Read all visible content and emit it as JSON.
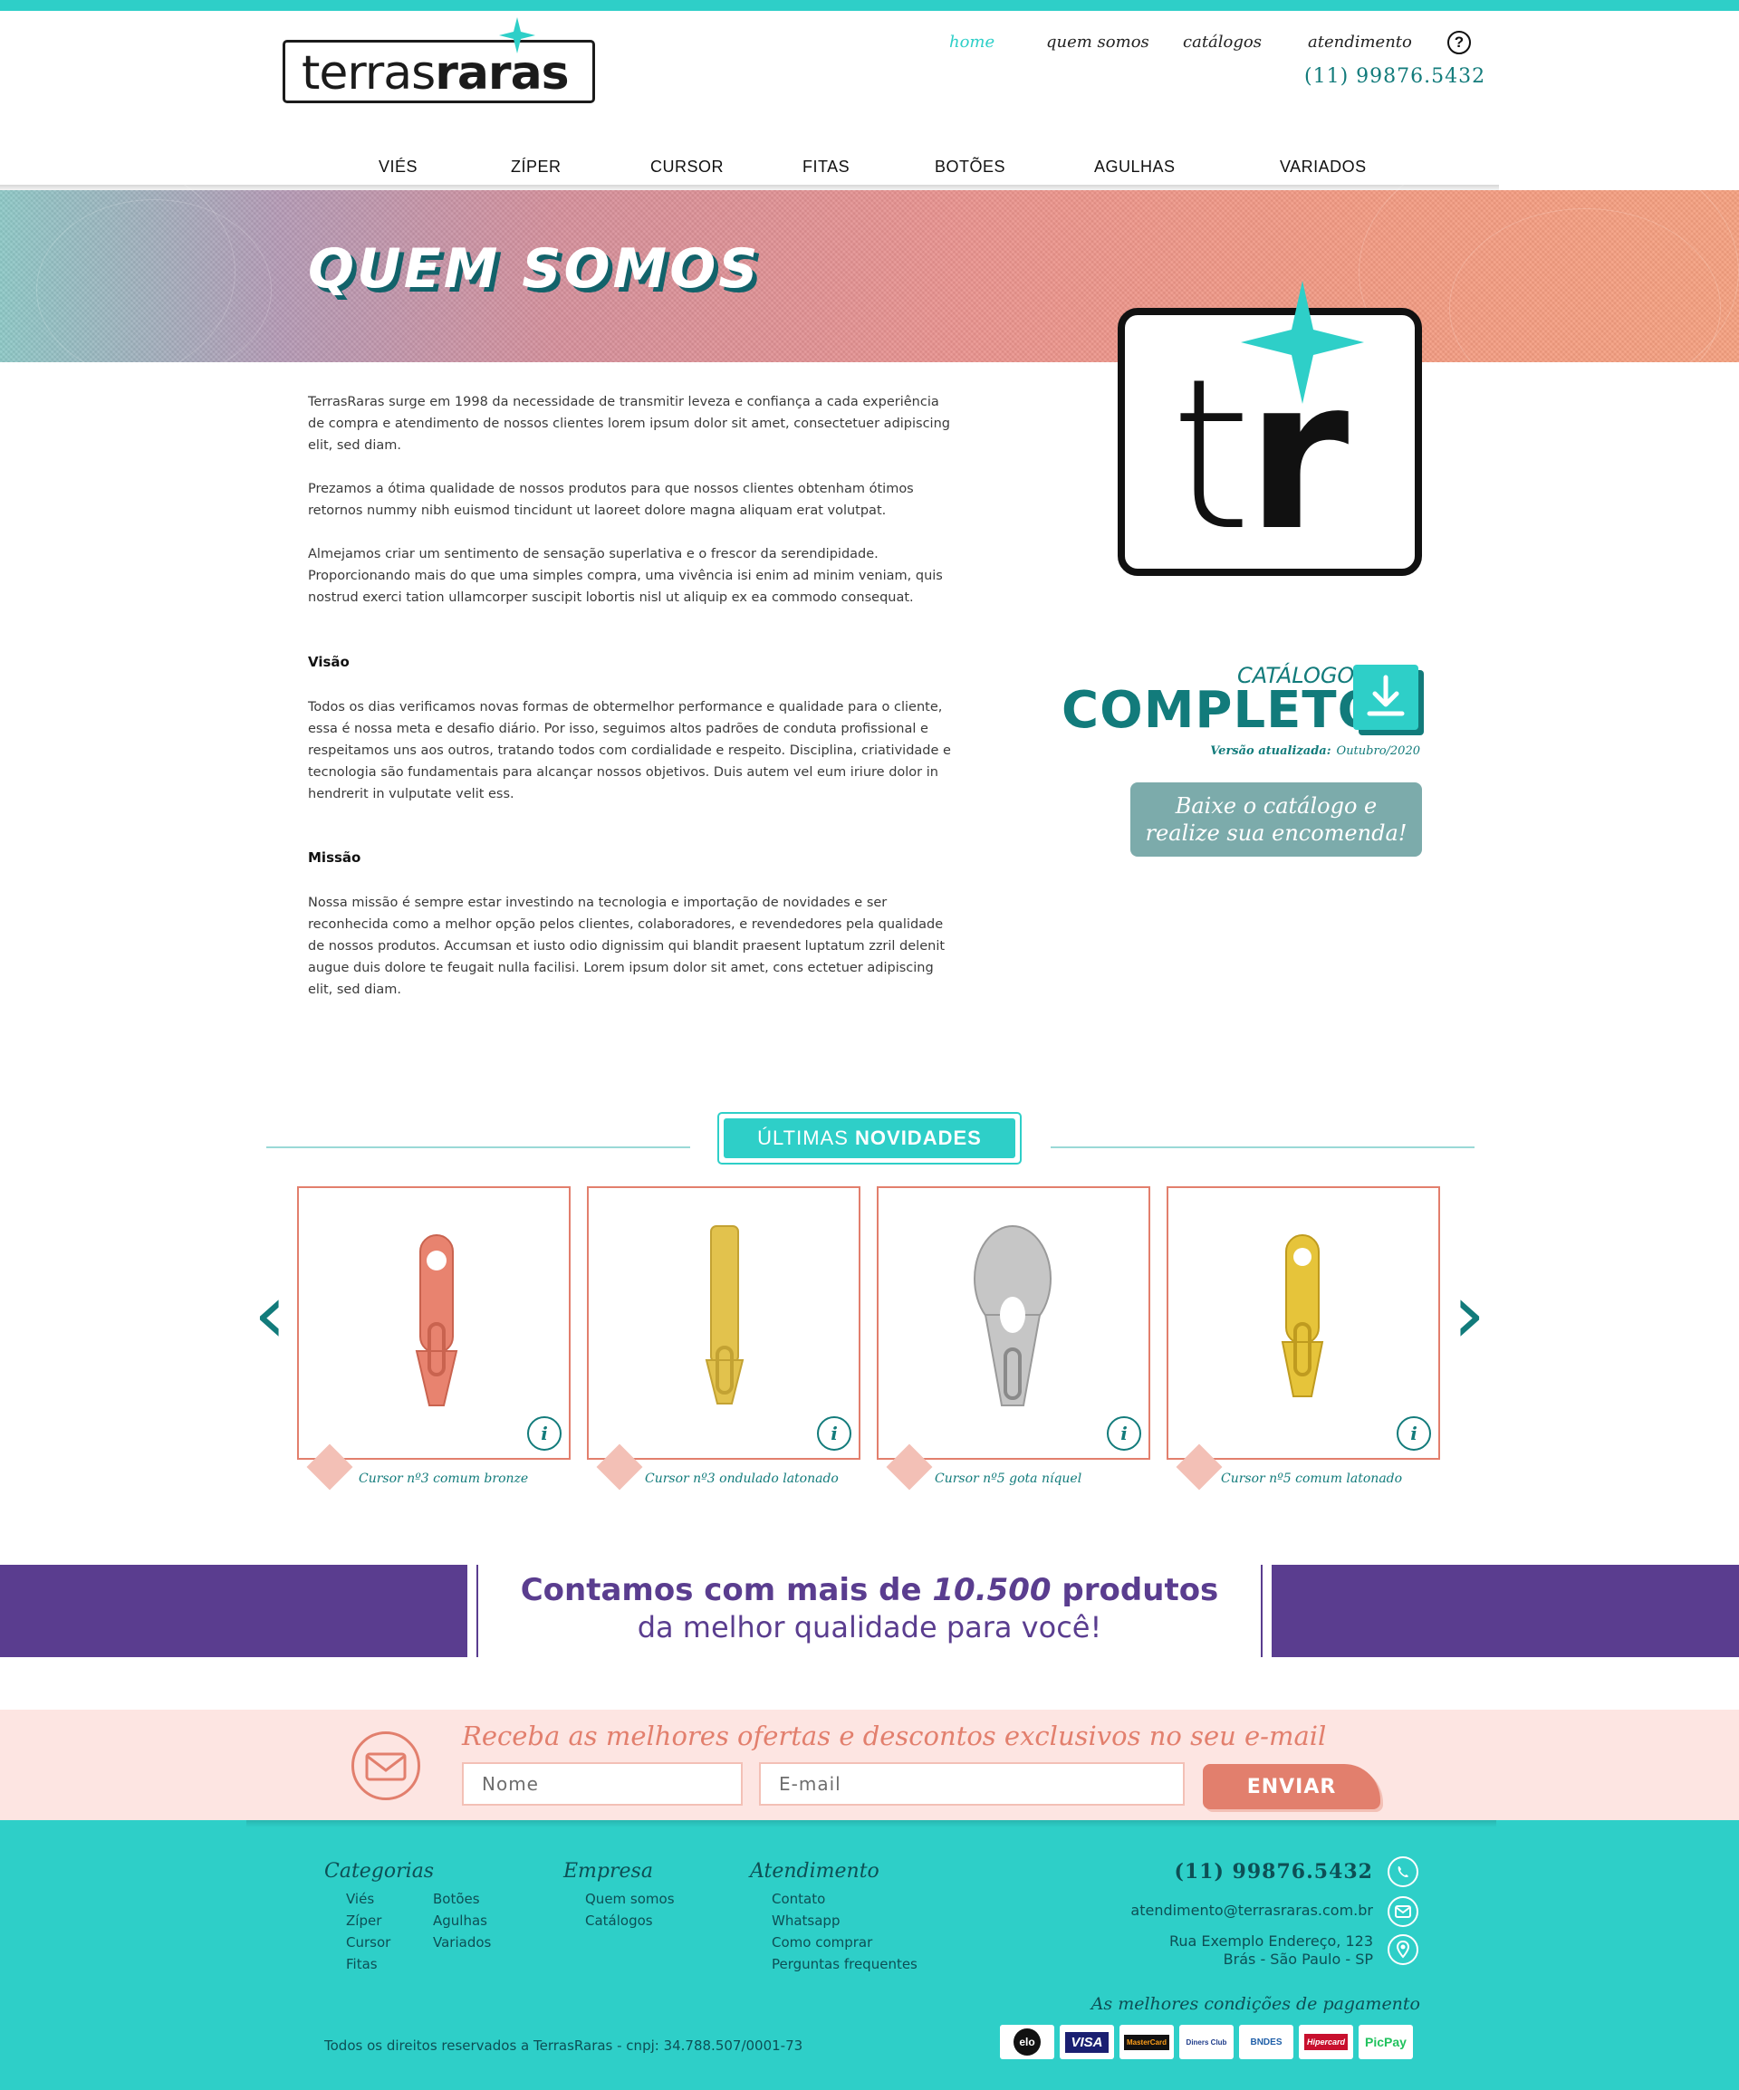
{
  "brand": {
    "logo_text_light": "terras",
    "logo_text_bold": "raras",
    "accent_teal": "#2ecfc8",
    "dark_teal": "#127b7b",
    "coral": "#e27f6d",
    "purple": "#5a3d8f"
  },
  "header": {
    "nav": [
      {
        "label": "home",
        "active": true
      },
      {
        "label": "quem somos",
        "active": false
      },
      {
        "label": "catálogos",
        "active": false
      },
      {
        "label": "atendimento",
        "active": false
      }
    ],
    "help_icon": "question-circle-icon",
    "phone": "(11) 99876.5432"
  },
  "categories": [
    "VIÉS",
    "ZÍPER",
    "CURSOR",
    "FITAS",
    "BOTÕES",
    "AGULHAS",
    "VARIADOS"
  ],
  "hero": {
    "title": "QUEM SOMOS"
  },
  "content": {
    "paragraphs": [
      "TerrasRaras surge em 1998 da necessidade de transmitir leveza e confiança a cada experiência de compra e atendimento de nossos clientes lorem ipsum dolor sit amet, consectetuer adipiscing elit, sed diam.",
      "Prezamos a ótima qualidade de nossos produtos para que nossos clientes obtenham ótimos retornos nummy nibh euismod tincidunt ut laoreet dolore magna aliquam erat volutpat.",
      "Almejamos criar um sentimento de sensação superlativa e o frescor da serendipidade. Proporcionando mais do que uma simples compra, uma vivência isi enim ad minim veniam, quis nostrud exerci tation ullamcorper suscipit lobortis nisl ut aliquip ex ea commodo consequat."
    ],
    "visao_title": "Visão",
    "visao_text": "Todos os dias verificamos novas formas de obtermelhor performance e qualidade para o cliente, essa é nossa meta e desafio diário. Por isso, seguimos altos padrões de conduta profissional e respeitamos uns aos outros, tratando todos com cordialidade e respeito. Disciplina, criatividade e tecnologia são fundamentais para alcançar nossos objetivos. Duis autem vel eum iriure dolor in hendrerit in vulputate velit ess.",
    "missao_title": "Missão",
    "missao_text": "Nossa missão é sempre estar investindo na tecnologia e importação de novidades e ser reconhecida como a melhor opção pelos clientes, colaboradores, e revendedores pela qualidade de nossos produtos. Accumsan et iusto odio dignissim qui blandit praesent luptatum zzril delenit augue duis dolore te feugait nulla facilisi. Lorem ipsum dolor sit amet, cons ectetuer adipiscing elit, sed diam."
  },
  "big_logo": {
    "letter_light": "t",
    "letter_bold": "r"
  },
  "catalog": {
    "small_title": "CATÁLOGO",
    "big_title": "COMPLETO",
    "download_icon": "download-icon",
    "version_label": "Versão atualizada:",
    "version_value": "Outubro/2020",
    "button_line1": "Baixe o catálogo e",
    "button_line2": "realize sua encomenda!"
  },
  "novidades": {
    "title_light": "ÚLTIMAS",
    "title_bold": "NOVIDADES",
    "prev_icon": "chevron-left-icon",
    "next_icon": "chevron-right-icon",
    "products": [
      {
        "name": "Cursor nº3 comum bronze",
        "color": "#e8836f"
      },
      {
        "name": "Cursor nº3 ondulado latonado",
        "color": "#e2c24d"
      },
      {
        "name": "Cursor nº5 gota níquel",
        "color": "#bfbfbf"
      },
      {
        "name": "Cursor nº5 comum latonado",
        "color": "#e6c43a"
      }
    ],
    "info_label": "i"
  },
  "promo": {
    "line1_pre": "Contamos com mais de ",
    "line1_number": "10.500",
    "line1_post": " produtos",
    "line2": "da melhor qualidade para você!"
  },
  "newsletter": {
    "title": "Receba as melhores ofertas e descontos exclusivos no seu e-mail",
    "name_placeholder": "Nome",
    "email_placeholder": "E-mail",
    "button": "ENVIAR"
  },
  "footer": {
    "categorias_title": "Categorias",
    "categorias_col1": [
      "Viés",
      "Zíper",
      "Cursor",
      "Fitas"
    ],
    "categorias_col2": [
      "Botões",
      "Agulhas",
      "Variados"
    ],
    "empresa_title": "Empresa",
    "empresa_links": [
      "Quem somos",
      "Catálogos"
    ],
    "atendimento_title": "Atendimento",
    "atendimento_links": [
      "Contato",
      "Whatsapp",
      "Como comprar",
      "Perguntas frequentes"
    ],
    "phone": "(11) 99876.5432",
    "email": "atendimento@terrasraras.com.br",
    "address_line1": "Rua Exemplo Endereço, 123",
    "address_line2": "Brás - São Paulo - SP",
    "payment_title": "As melhores condições de pagamento",
    "payment_methods": [
      "elo",
      "VISA",
      "MasterCard",
      "Diners Club",
      "BNDES",
      "Hipercard",
      "PicPay"
    ],
    "copyright": "Todos os direitos reservados a TerrasRaras - cnpj: 34.788.507/0001-73"
  }
}
